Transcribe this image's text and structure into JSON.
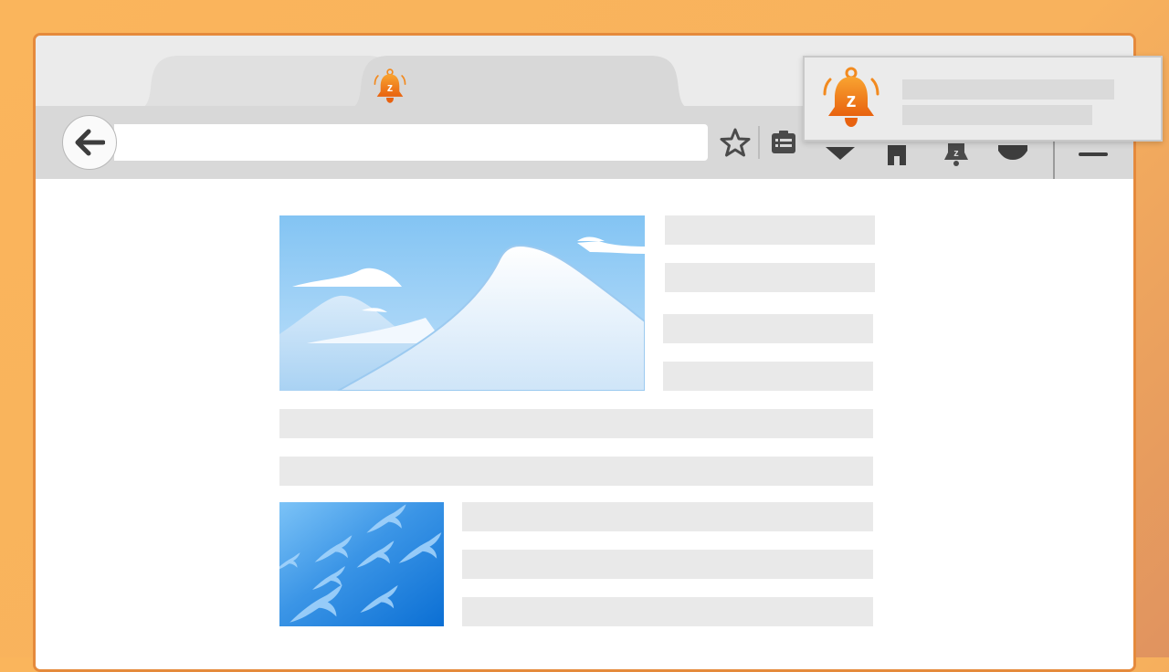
{
  "browser": {
    "address_bar": {
      "value": "",
      "placeholder": ""
    },
    "tabs": [
      {
        "label": "",
        "icon": "snooze-bell-icon",
        "active": false
      },
      {
        "label": "",
        "icon": "snooze-bell-icon",
        "active": true
      }
    ],
    "toolbar_icons": [
      "star-icon",
      "reading-list-icon",
      "pocket-icon",
      "home-icon",
      "snooze-bell-icon",
      "extension-icon",
      "hamburger-menu-icon"
    ]
  },
  "notification": {
    "icon": "snooze-bell-icon",
    "title": "",
    "body": ""
  },
  "colors": {
    "accent_orange": "#f7941d",
    "background_orange": "#f9b55c"
  }
}
